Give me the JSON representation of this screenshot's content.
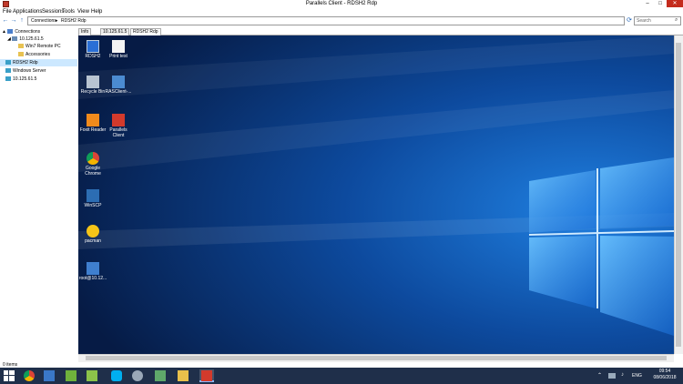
{
  "window": {
    "title": "Parallels Client - RDSH2 Rdp",
    "minimize": "–",
    "maximize": "□",
    "close": "✕"
  },
  "menu": [
    "File",
    "Applications",
    "Sessions",
    "Tools",
    "View",
    "Help"
  ],
  "nav": {
    "back": "←",
    "forward": "→",
    "up": "↑",
    "refresh": "⟳"
  },
  "address": {
    "root": "Connections",
    "separator": "▸",
    "current": "RDSH2 Rdp"
  },
  "search": {
    "placeholder": "Search",
    "icon": "⌕"
  },
  "tree": {
    "root": {
      "label": "Connections",
      "toggle": "▲"
    },
    "server": {
      "label": "10.125.61.5",
      "toggle": "◢"
    },
    "child1": "Win7 Remote PC",
    "child2": "Accessories",
    "rdsh2": "RDSH2 Rdp",
    "windows": "Windows Server",
    "server2": "10.125.61.5"
  },
  "tabs": [
    "Info",
    "10.125.61.5",
    "RDSH2 Rdp"
  ],
  "desktop_icons": [
    {
      "label": "RDSH2"
    },
    {
      "label": "Print test"
    },
    {
      "label": "Recycle Bin"
    },
    {
      "label": "RASClient-..."
    },
    {
      "label": "Foxit Reader"
    },
    {
      "label": "Parallels Client"
    },
    {
      "label": "Google Chrome"
    },
    {
      "label": "WinSCP"
    },
    {
      "label": "pacman"
    },
    {
      "label": "root@10.12..."
    }
  ],
  "status": {
    "items": "0 items"
  },
  "tray": {
    "chevron": "⌃",
    "volume": "♪",
    "lang": "ENG"
  },
  "clock": {
    "time": "09:54",
    "date": "08/06/2018"
  },
  "colors": {
    "accent": "#1a5fb4",
    "close_red": "#c42b1c",
    "taskbar": "#1f2f4a",
    "desktop": "#0b2b63"
  }
}
